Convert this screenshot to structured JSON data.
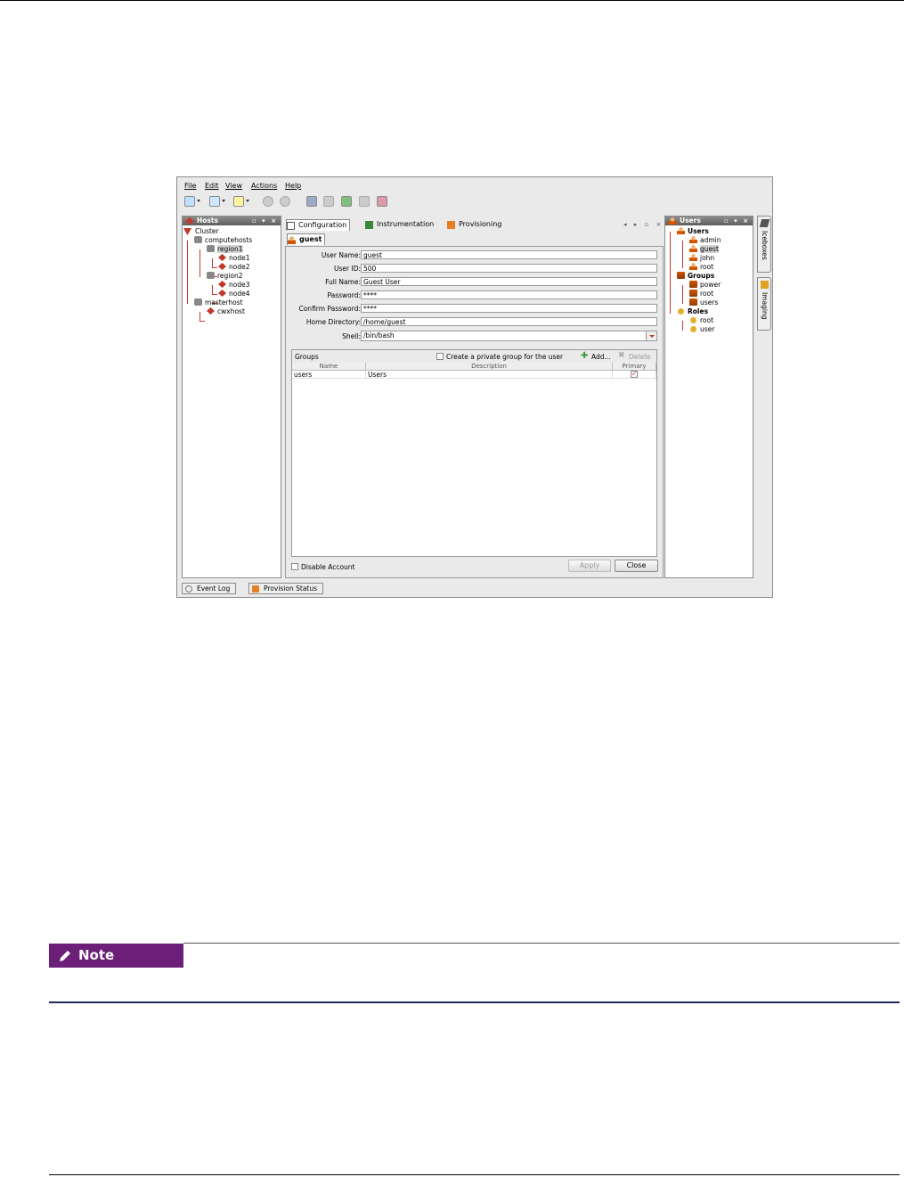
{
  "menu": [
    "File",
    "Edit",
    "View",
    "Actions",
    "Help"
  ],
  "hosts_panel": {
    "title": "Hosts",
    "tree": [
      {
        "label": "Cluster",
        "level": 0
      },
      {
        "label": "computehosts",
        "level": 1
      },
      {
        "label": "region1",
        "level": 2,
        "selected": true
      },
      {
        "label": "node1",
        "level": 3
      },
      {
        "label": "node2",
        "level": 3
      },
      {
        "label": "region2",
        "level": 2
      },
      {
        "label": "node3",
        "level": 3
      },
      {
        "label": "node4",
        "level": 3
      },
      {
        "label": "masterhost",
        "level": 1
      },
      {
        "label": "cwxhost",
        "level": 2
      }
    ]
  },
  "tabs": [
    "Configuration",
    "Instrumentation",
    "Provisioning"
  ],
  "subtab": "guest",
  "form": {
    "fields": [
      {
        "label": "User Name:",
        "value": "guest"
      },
      {
        "label": "User ID:",
        "value": "500"
      },
      {
        "label": "Full Name:",
        "value": "Guest User"
      },
      {
        "label": "Password:",
        "value": "****"
      },
      {
        "label": "Confirm Password:",
        "value": "****"
      },
      {
        "label": "Home Directory:",
        "value": "/home/guest"
      },
      {
        "label": "Shell:",
        "value": "/bin/bash"
      }
    ],
    "groups": {
      "title": "Groups",
      "private_group_label": "Create a private group for the user",
      "add_label": "Add...",
      "delete_label": "Delete",
      "columns": [
        "Name",
        "Description",
        "Primary"
      ],
      "rows": [
        {
          "name": "users",
          "description": "Users",
          "primary": true
        }
      ]
    },
    "disable_account_label": "Disable Account",
    "apply_label": "Apply",
    "close_label": "Close"
  },
  "users_panel": {
    "title": "Users",
    "tree": [
      {
        "label": "Users",
        "kind": "user",
        "level": 0
      },
      {
        "label": "admin",
        "kind": "user",
        "level": 1
      },
      {
        "label": "guest",
        "kind": "user",
        "level": 1,
        "selected": true
      },
      {
        "label": "john",
        "kind": "user",
        "level": 1
      },
      {
        "label": "root",
        "kind": "user",
        "level": 1
      },
      {
        "label": "Groups",
        "kind": "group",
        "level": 0
      },
      {
        "label": "power",
        "kind": "group",
        "level": 1
      },
      {
        "label": "root",
        "kind": "group",
        "level": 1
      },
      {
        "label": "users",
        "kind": "group",
        "level": 1
      },
      {
        "label": "Roles",
        "kind": "role",
        "level": 0
      },
      {
        "label": "root",
        "kind": "role",
        "level": 1
      },
      {
        "label": "user",
        "kind": "role",
        "level": 1
      }
    ]
  },
  "side_tabs": [
    "Iceboxes",
    "Imaging"
  ],
  "bottom_tabs": [
    "Event Log",
    "Provision Status"
  ],
  "note": {
    "label": "Note"
  },
  "colors": {
    "note_badge": "#6b1f78",
    "rule": "#1f2a5c"
  }
}
